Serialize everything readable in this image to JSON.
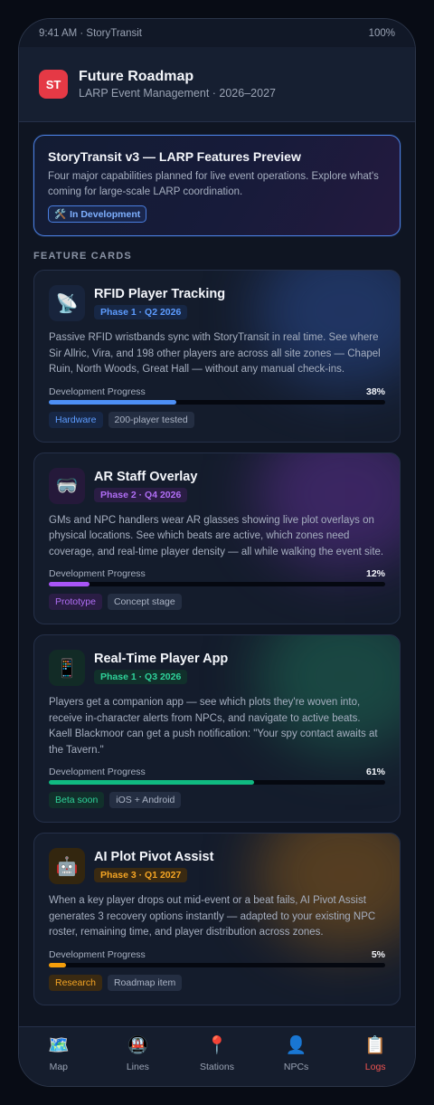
{
  "status": {
    "left": "9:41 AM · StoryTransit",
    "right": "100%"
  },
  "header": {
    "logo": "ST",
    "title": "Future Roadmap",
    "subtitle": "LARP Event Management · 2026–2027"
  },
  "preview": {
    "title": "StoryTransit v3 — LARP Features Preview",
    "description": "Four major capabilities planned for live event operations. Explore what's coming for large-scale LARP coordination.",
    "badge_icon": "🛠️",
    "badge": "In Development"
  },
  "section_label": "FEATURE CARDS",
  "features": [
    {
      "icon": "📡",
      "icon_name": "satellite-dish-icon",
      "title": "RFID Player Tracking",
      "phase": "Phase 1 · Q2 2026",
      "description": "Passive RFID wristbands sync with StoryTransit in real time. See where Sir Allric, Vira, and 198 other players are across all site zones — Chapel Ruin, North Woods, Great Hall — without any manual check-ins.",
      "progress_label": "Development Progress",
      "progress": 38,
      "progress_text": "38%",
      "accent": "#4d8ff5",
      "accent_text": "#5d9cff",
      "accent_bg": "#172745",
      "icon_bg": "#18243c",
      "glow": "#2a4a8f",
      "tags": [
        "Hardware",
        "200-player tested"
      ]
    },
    {
      "icon": "🥽",
      "icon_name": "goggles-icon",
      "title": "AR Staff Overlay",
      "phase": "Phase 2 · Q4 2026",
      "description": "GMs and NPC handlers wear AR glasses showing live plot overlays on physical locations. See which beats are active, which zones need coverage, and real-time player density — all while walking the event site.",
      "progress_label": "Development Progress",
      "progress": 12,
      "progress_text": "12%",
      "accent": "#a855f7",
      "accent_text": "#b06ef5",
      "accent_bg": "#2a1d44",
      "icon_bg": "#25193a",
      "glow": "#5b2f8f",
      "tags": [
        "Prototype",
        "Concept stage"
      ]
    },
    {
      "icon": "📱",
      "icon_name": "mobile-phone-icon",
      "title": "Real-Time Player App",
      "phase": "Phase 1 · Q3 2026",
      "description": "Players get a companion app — see which plots they're woven into, receive in-character alerts from NPCs, and navigate to active beats. Kaell Blackmoor can get a push notification: \"Your spy contact awaits at the Tavern.\"",
      "progress_label": "Development Progress",
      "progress": 61,
      "progress_text": "61%",
      "accent": "#10b981",
      "accent_text": "#2fd39a",
      "accent_bg": "#11302b",
      "icon_bg": "#122b26",
      "glow": "#1f6b55",
      "tags": [
        "Beta soon",
        "iOS + Android"
      ]
    },
    {
      "icon": "🤖",
      "icon_name": "robot-icon",
      "title": "AI Plot Pivot Assist",
      "phase": "Phase 3 · Q1 2027",
      "description": "When a key player drops out mid-event or a beat fails, AI Pivot Assist generates 3 recovery options instantly — adapted to your existing NPC roster, remaining time, and player distribution across zones.",
      "progress_label": "Development Progress",
      "progress": 5,
      "progress_text": "5%",
      "accent": "#f59e0b",
      "accent_text": "#f5a524",
      "accent_bg": "#3a2a12",
      "icon_bg": "#33260f",
      "glow": "#8a5a1a",
      "tags": [
        "Research",
        "Roadmap item"
      ]
    }
  ],
  "tabs": [
    {
      "icon": "🗺️",
      "icon_name": "map-icon",
      "label": "Map",
      "active": false
    },
    {
      "icon": "🚇",
      "icon_name": "metro-icon",
      "label": "Lines",
      "active": false
    },
    {
      "icon": "📍",
      "icon_name": "pin-icon",
      "label": "Stations",
      "active": false
    },
    {
      "icon": "👤",
      "icon_name": "person-icon",
      "label": "NPCs",
      "active": false
    },
    {
      "icon": "📋",
      "icon_name": "clipboard-icon",
      "label": "Logs",
      "active": true
    }
  ]
}
